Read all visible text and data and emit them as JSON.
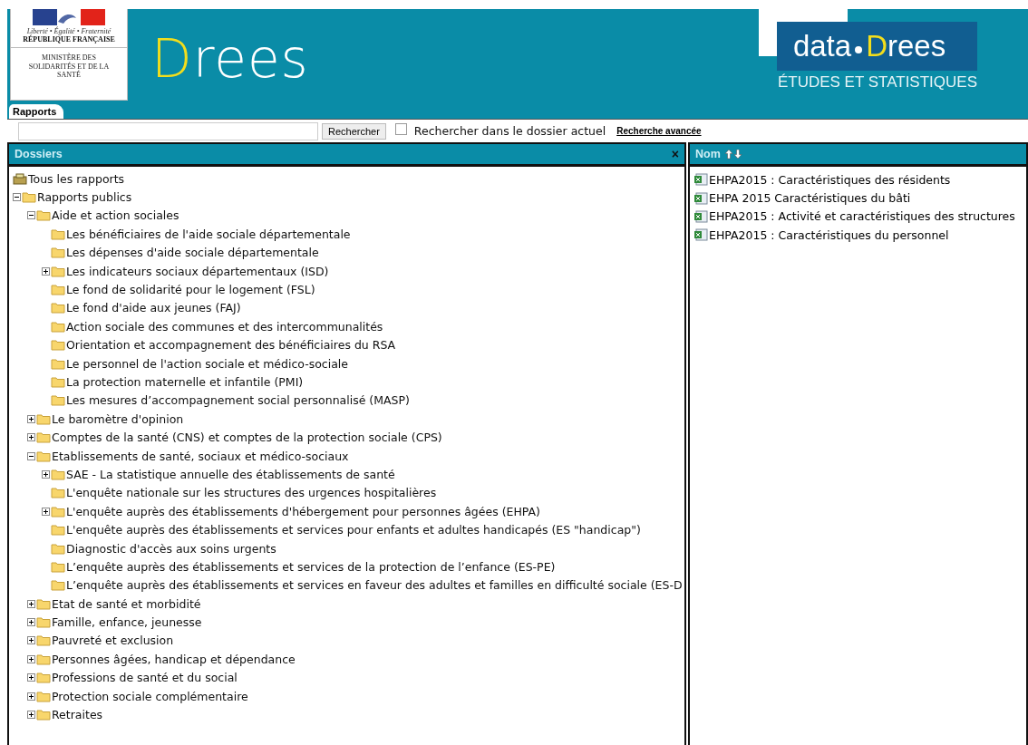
{
  "header": {
    "marianne": {
      "motto": "Liberté • Égalité • Fraternité",
      "country": "RÉPUBLIQUE FRANÇAISE",
      "ministry": "MINISTÈRE DES SOLIDARITÉS ET DE LA SANTÉ"
    },
    "logo": "Drees",
    "data_logo": {
      "prefix": "data",
      "name": "Drees",
      "tagline": "ÉTUDES ET STATISTIQUES"
    }
  },
  "tabs": [
    {
      "label": "Rapports",
      "selected": true
    }
  ],
  "search": {
    "button": "Rechercher",
    "scope_checked": false,
    "scope_label": "Rechercher dans le dossier actuel",
    "advanced_link": "Recherche avancée"
  },
  "folders_panel": {
    "title": "Dossiers",
    "close": "×",
    "tree": [
      {
        "label": "Tous les rapports",
        "kind": "root",
        "children": [
          {
            "label": "Rapports publics",
            "kind": "folder",
            "expanded": true,
            "children": [
              {
                "label": "Aide et action sociales",
                "kind": "folder",
                "expanded": true,
                "children": [
                  {
                    "label": "Les bénéficiaires de l'aide sociale départementale",
                    "kind": "folder"
                  },
                  {
                    "label": "Les dépenses d'aide sociale départementale",
                    "kind": "folder"
                  },
                  {
                    "label": "Les indicateurs sociaux départementaux (ISD)",
                    "kind": "folder",
                    "expanded": false
                  },
                  {
                    "label": "Le fond de solidarité pour le logement (FSL)",
                    "kind": "folder"
                  },
                  {
                    "label": "Le fond d'aide aux jeunes (FAJ)",
                    "kind": "folder"
                  },
                  {
                    "label": "Action sociale des communes et des intercommunalités",
                    "kind": "folder"
                  },
                  {
                    "label": "Orientation et accompagnement des bénéficiaires du RSA",
                    "kind": "folder"
                  },
                  {
                    "label": "Le personnel de l'action sociale et médico-sociale",
                    "kind": "folder"
                  },
                  {
                    "label": "La protection maternelle et infantile (PMI)",
                    "kind": "folder"
                  },
                  {
                    "label": "Les mesures d’accompagnement social personnalisé (MASP)",
                    "kind": "folder"
                  }
                ]
              },
              {
                "label": "Le baromètre d'opinion",
                "kind": "folder",
                "expanded": false
              },
              {
                "label": "Comptes de la santé (CNS) et comptes de la protection sociale (CPS)",
                "kind": "folder",
                "expanded": false
              },
              {
                "label": "Etablissements de santé, sociaux et médico-sociaux",
                "kind": "folder",
                "expanded": true,
                "children": [
                  {
                    "label": "SAE - La statistique annuelle des établissements de santé",
                    "kind": "folder",
                    "expanded": false
                  },
                  {
                    "label": "L'enquête nationale sur les structures des urgences hospitalières",
                    "kind": "folder"
                  },
                  {
                    "label": "L'enquête auprès des établissements d'hébergement pour personnes âgées (EHPA)",
                    "kind": "folder",
                    "expanded": false
                  },
                  {
                    "label": "L'enquête auprès des établissements et services pour enfants et adultes handicapés (ES \"handicap\")",
                    "kind": "folder"
                  },
                  {
                    "label": "Diagnostic d'accès aux soins urgents",
                    "kind": "folder"
                  },
                  {
                    "label": "L’enquête auprès des établissements et services de la protection de l’enfance (ES-PE)",
                    "kind": "folder"
                  },
                  {
                    "label": "L’enquête auprès des établissements et services en faveur des adultes et familles en difficulté sociale (ES-D",
                    "kind": "folder"
                  }
                ]
              },
              {
                "label": "Etat de santé et morbidité",
                "kind": "folder",
                "expanded": false
              },
              {
                "label": "Famille, enfance, jeunesse",
                "kind": "folder",
                "expanded": false
              },
              {
                "label": "Pauvreté et exclusion",
                "kind": "folder",
                "expanded": false
              },
              {
                "label": "Personnes âgées, handicap et dépendance",
                "kind": "folder",
                "expanded": false
              },
              {
                "label": "Professions de santé et du social",
                "kind": "folder",
                "expanded": false
              },
              {
                "label": "Protection sociale complémentaire",
                "kind": "folder",
                "expanded": false
              },
              {
                "label": "Retraites",
                "kind": "folder",
                "expanded": false
              }
            ]
          }
        ]
      }
    ]
  },
  "files_panel": {
    "column": "Nom",
    "files": [
      {
        "name": "EHPA2015 : Caractéristiques des résidents"
      },
      {
        "name": "EHPA 2015  Caractéristiques du bâti"
      },
      {
        "name": "EHPA2015 : Activité et caractéristiques des structures"
      },
      {
        "name": "EHPA2015 : Caractéristiques du personnel"
      }
    ]
  }
}
